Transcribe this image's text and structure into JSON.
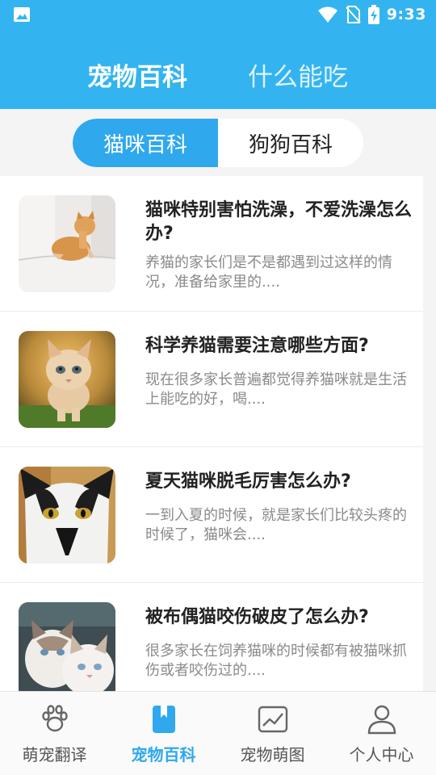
{
  "status_bar": {
    "time": "9:33",
    "icons": [
      "image-notification-icon",
      "wifi-icon",
      "no-sim-icon",
      "battery-charging-icon"
    ]
  },
  "header": {
    "tabs": [
      {
        "label": "宠物百科",
        "active": true
      },
      {
        "label": "什么能吃",
        "active": false
      }
    ]
  },
  "segment": {
    "options": [
      {
        "label": "猫咪百科",
        "active": true
      },
      {
        "label": "狗狗百科",
        "active": false
      }
    ]
  },
  "articles": [
    {
      "title": "猫咪特别害怕洗澡，不爱洗澡怎么办?",
      "summary": "养猫的家长们是不是都遇到过这样的情况，准备给家里的....",
      "image": "orange-kitten-on-bathtub"
    },
    {
      "title": "科学养猫需要注意哪些方面?",
      "summary": "现在很多家长普遍都觉得养猫咪就是生活上能吃的好，喝....",
      "image": "fluffy-kitten-on-grass"
    },
    {
      "title": "夏天猫咪脱毛厉害怎么办?",
      "summary": "一到入夏的时候，就是家长们比较头疼的时候了，猫咪会....",
      "image": "black-white-cat-face"
    },
    {
      "title": "被布偶猫咬伤破皮了怎么办?",
      "summary": "很多家长在饲养猫咪的时候都有被猫咪抓伤或者咬伤过的....",
      "image": "two-ragdoll-cats"
    }
  ],
  "bottom_nav": {
    "items": [
      {
        "label": "萌宠翻译",
        "icon": "paw-icon",
        "active": false
      },
      {
        "label": "宠物百科",
        "icon": "book-icon",
        "active": true
      },
      {
        "label": "宠物萌图",
        "icon": "picture-icon",
        "active": false
      },
      {
        "label": "个人中心",
        "icon": "person-icon",
        "active": false
      }
    ]
  },
  "colors": {
    "primary": "#33b4f1",
    "segment_active": "#2fa8ee",
    "nav_active": "#2fa8ee",
    "title_text": "#222222",
    "summary_text": "#8a8a8a"
  }
}
